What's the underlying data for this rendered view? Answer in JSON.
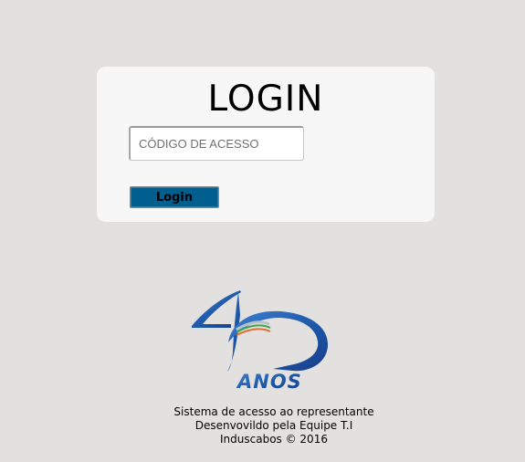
{
  "login": {
    "title": "LOGIN",
    "code_placeholder": "CÓDIGO DE ACESSO",
    "code_value": "",
    "button_label": "Login"
  },
  "logo": {
    "text": "ANOS",
    "colors": {
      "primary": "#1d57a8",
      "dark": "#193d8a",
      "light": "#3f7fd1"
    }
  },
  "footer": {
    "line1": "Sistema de acesso ao representante",
    "line2": "Desenvovildo pela Equipe T.I",
    "line3": "Induscabos © 2016"
  }
}
